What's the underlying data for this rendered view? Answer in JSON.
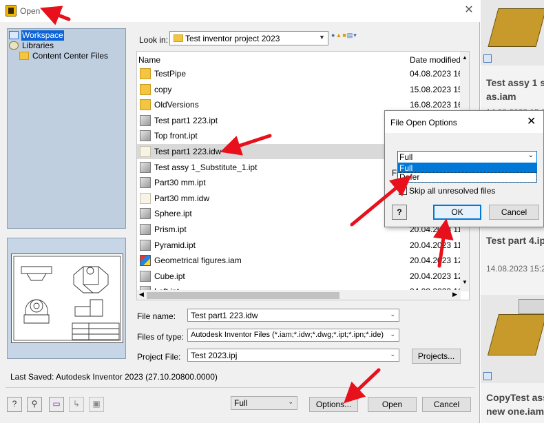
{
  "dialog": {
    "title": "Open",
    "nav_items": [
      "Workspace",
      "Libraries",
      "Content Center Files"
    ],
    "look_in_label": "Look in:",
    "look_in_value": "Test inventor project 2023",
    "columns": {
      "name": "Name",
      "date": "Date modified"
    },
    "files": [
      {
        "name": "TestPipe",
        "date": "04.08.2023 16",
        "icon": "folder-icon"
      },
      {
        "name": "copy",
        "date": "15.08.2023 15",
        "icon": "folder-icon"
      },
      {
        "name": "OldVersions",
        "date": "16.08.2023 16",
        "icon": "folder-icon"
      },
      {
        "name": "Test part1 223.ipt",
        "date": "",
        "icon": "part-icon"
      },
      {
        "name": "Top front.ipt",
        "date": "",
        "icon": "part-icon"
      },
      {
        "name": "Test part1 223.idw",
        "date": "",
        "icon": "drawing-icon"
      },
      {
        "name": "Test assy 1_Substitute_1.ipt",
        "date": "",
        "icon": "part-icon"
      },
      {
        "name": "Part30 mm.ipt",
        "date": "",
        "icon": "part-icon"
      },
      {
        "name": "Part30 mm.idw",
        "date": "",
        "icon": "drawing-icon"
      },
      {
        "name": "Sphere.ipt",
        "date": "",
        "icon": "part-icon"
      },
      {
        "name": "Prism.ipt",
        "date": "20.04.2023 11",
        "icon": "part-icon"
      },
      {
        "name": "Pyramid.ipt",
        "date": "20.04.2023 11",
        "icon": "part-icon"
      },
      {
        "name": "Geometrical figures.iam",
        "date": "20.04.2023 12",
        "icon": "assembly-icon"
      },
      {
        "name": "Cube.ipt",
        "date": "20.04.2023 12",
        "icon": "part-icon"
      },
      {
        "name": "Left.ipt",
        "date": "04.08.2023 16",
        "icon": "part-icon"
      }
    ],
    "file_name_label": "File name:",
    "file_name_value": "Test part1 223.idw",
    "files_of_type_label": "Files of type:",
    "files_of_type_value": "Autodesk Inventor Files (*.iam;*.idw;*.dwg;*.ipt;*.ipn;*.ide)",
    "project_file_label": "Project File:",
    "project_file_value": "Test 2023.ipj",
    "projects_button": "Projects...",
    "last_saved": "Last Saved: Autodesk Inventor 2023 (27.10.20800.0000)",
    "open_mode_value": "Full",
    "options_button": "Options...",
    "open_button": "Open",
    "cancel_button": "Cancel"
  },
  "popup": {
    "title": "File Open Options",
    "combo_value": "Full",
    "options": [
      "Full",
      "Defer"
    ],
    "hidden_label_fragment": "F",
    "skip_label": "Skip all unresolved files",
    "help_label": "?",
    "ok_button": "OK",
    "cancel_button": "Cancel"
  },
  "background_cards": [
    {
      "title": "Test assy 1 sa\nas.iam",
      "date": "14.08.2023 15:3"
    },
    {
      "title": "Test part 4.ip",
      "date": "14.08.2023 15:2"
    },
    {
      "title": "CopyTest ass\nnew one.iam",
      "date": ""
    }
  ],
  "colors": {
    "accent": "#0078d7",
    "selection": "#0a64d8",
    "annotation": "#e8101a"
  }
}
